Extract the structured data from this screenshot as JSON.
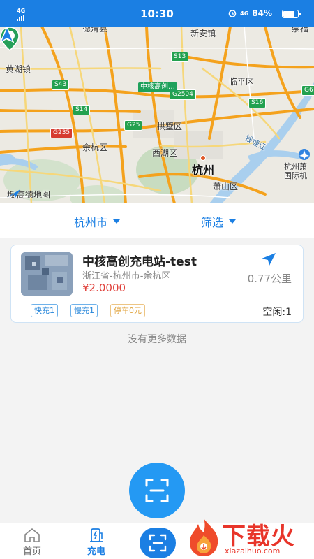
{
  "status_bar": {
    "network_left": "4G",
    "time": "10:30",
    "network_right": "4G",
    "battery": "84%"
  },
  "map": {
    "labels": {
      "deqing": "德清县",
      "xinanzhen": "新安镇",
      "chongfu": "崇福",
      "huanghuzhen": "黄湖镇",
      "linping": "临平区",
      "gongshu": "拱墅区",
      "yuhang": "余杭区",
      "xihu": "西湖区",
      "hangzhou": "杭州",
      "qiantangjiang": "钱塘江",
      "xiaoshan": "萧山区",
      "airport": "杭州萧\n国际机"
    },
    "roads": [
      "S13",
      "S43",
      "G2504",
      "S16",
      "S14",
      "G25",
      "G235",
      "G6"
    ],
    "station_tag": "中核高创…",
    "cluster_count": "1",
    "logo": "高德地图",
    "left_edge_label": "坂"
  },
  "filter": {
    "city": "杭州市",
    "screen": "筛选"
  },
  "station": {
    "name": "中核高创充电站-test",
    "address": "浙江省-杭州市-余杭区",
    "price": "¥2.0000",
    "distance": "0.77公里",
    "tags": {
      "fast": "快充1",
      "slow": "慢充1",
      "park": "停车0元"
    },
    "idle": "空闲:1"
  },
  "no_more": "没有更多数据",
  "nav": {
    "home": "首页",
    "charge": "充电"
  },
  "watermark": {
    "title": "下载火",
    "sub": "xiazaihuo.com"
  },
  "colors": {
    "primary": "#1b7fe3",
    "price": "#e0403a",
    "fab": "#2499f3"
  }
}
